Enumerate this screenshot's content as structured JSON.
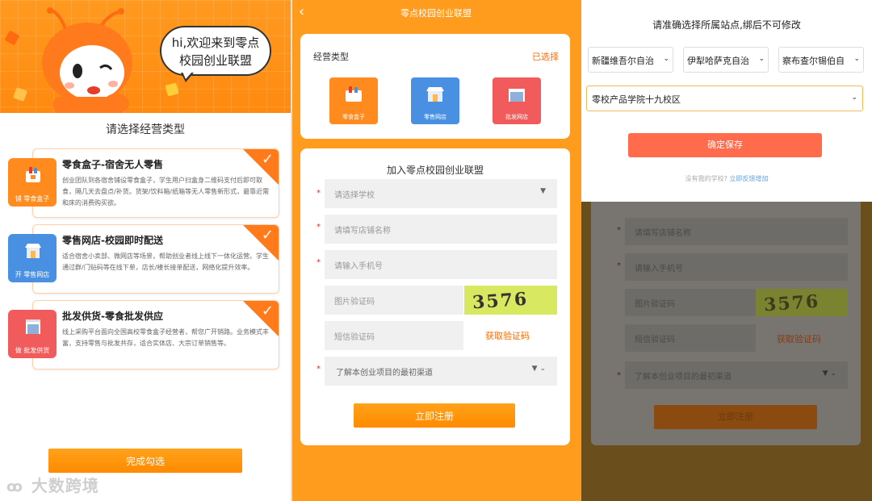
{
  "panel1": {
    "greeting": "hi,欢迎来到零点校园创业联盟",
    "greeting_line1": "hi,欢迎来到零点",
    "greeting_line2": "校园创业联盟",
    "title": "请选择经营类型",
    "business_types": [
      {
        "name": "零食盒子-宿舍无人零售",
        "desc": "创业团队到各宿舍铺设零食盒子，学生用户扫盒身二维码支付后即可取食，隔几天去盘点/补货。货架/饮料箱/纸箱等无人零售新形式，最靠近需和床的消费购买欲。",
        "icon_label": "铺 零食盒子",
        "icon": "snack-box-icon",
        "color": "#ff8a1e"
      },
      {
        "name": "零售网店-校园即时配送",
        "desc": "适合宿舍小卖部、微网店等场景，帮助创业者线上线下一体化运营。学生通过群/门贴码等在线下单，店长/楼长接单配送，网络化提升效率。",
        "icon_label": "开 零售网店",
        "icon": "shop-icon",
        "color": "#4a90e2"
      },
      {
        "name": "批发供货-零食批发供应",
        "desc": "线上采购平台面向全国高校零食盒子经营者，帮您广开销路。业务模式丰富，支持零售与批发共存，适合实体店、大宗订单销售等。",
        "icon_label": "做 批发供货",
        "icon": "warehouse-icon",
        "color": "#f25b5b"
      }
    ],
    "complete_button": "完成勾选",
    "watermark": "大数跨境"
  },
  "panel2": {
    "title": "零点校园创业联盟",
    "business_type_label": "经营类型",
    "selected_label": "已选择",
    "types": [
      {
        "label": "零食盒子",
        "color": "#ff8a1e",
        "icon": "snack-box-icon"
      },
      {
        "label": "零售网店",
        "color": "#4a90e2",
        "icon": "shop-icon"
      },
      {
        "label": "批发网店",
        "color": "#f25b5b",
        "icon": "warehouse-icon"
      }
    ],
    "form_title": "加入零点校园创业联盟",
    "fields": {
      "school_placeholder": "请选择学校",
      "shop_name_placeholder": "请填写店铺名称",
      "phone_placeholder": "请输入手机号",
      "image_code_placeholder": "图片验证码",
      "captcha_text": "3576",
      "sms_code_placeholder": "短信验证码",
      "get_code_label": "获取验证码",
      "channel_placeholder": "了解本创业项目的最初渠道"
    },
    "register_button": "立即注册"
  },
  "panel3": {
    "title": "请准确选择所属站点,绑后不可修改",
    "region1": "新疆维吾尔自治",
    "region2": "伊犁哈萨克自治",
    "region3": "察布查尔锡伯自",
    "school": "零校产品学院十九校区",
    "save_button": "确定保存",
    "hint_prefix": "没有我的学校?",
    "hint_link": "立即反馈增加",
    "dim_fields": {
      "shop_name_placeholder": "请填写店铺名称",
      "phone_placeholder": "请输入手机号",
      "image_code_placeholder": "图片验证码",
      "captcha_text": "3576",
      "sms_code_placeholder": "短信验证码",
      "get_code_label": "获取验证码",
      "channel_placeholder": "了解本创业项目的最初渠道",
      "register_button": "立即注册"
    }
  },
  "colors": {
    "brand_orange": "#ff9c1e",
    "accent_red": "#ff6b4b",
    "link_orange": "#ff6a00"
  }
}
